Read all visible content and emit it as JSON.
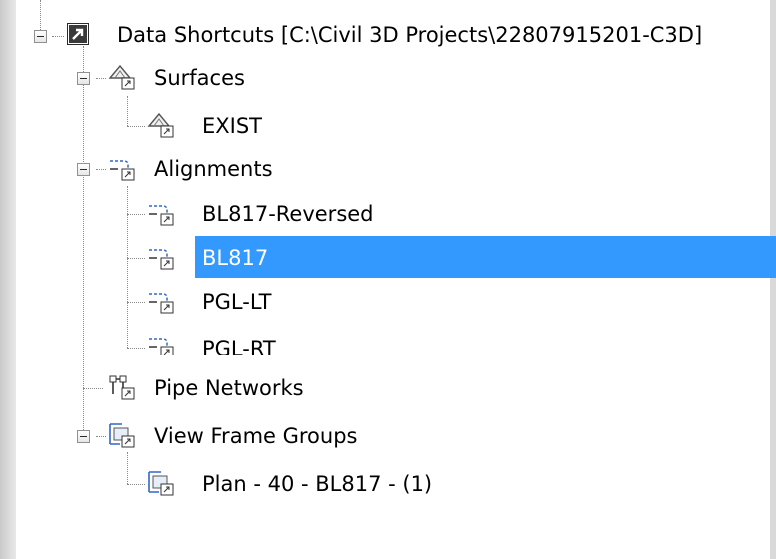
{
  "tree": {
    "root": {
      "label": "Data Shortcuts [C:\\Civil 3D Projects\\22807915201-C3D]",
      "icon": "shortcut-arrow-icon"
    },
    "surfaces": {
      "label": "Surfaces",
      "icon": "surface-icon",
      "children": [
        {
          "label": "EXIST",
          "icon": "surface-icon"
        }
      ]
    },
    "alignments": {
      "label": "Alignments",
      "icon": "alignment-icon",
      "children": [
        {
          "label": "BL817-Reversed",
          "icon": "alignment-icon"
        },
        {
          "label": "BL817",
          "icon": "alignment-icon",
          "selected": true
        },
        {
          "label": "PGL-LT",
          "icon": "alignment-icon"
        },
        {
          "label": "PGL-RT",
          "icon": "alignment-icon"
        }
      ]
    },
    "pipe_networks": {
      "label": "Pipe Networks",
      "icon": "pipe-network-icon"
    },
    "view_frame_groups": {
      "label": "View Frame Groups",
      "icon": "view-frame-icon",
      "children": [
        {
          "label": "Plan - 40 - BL817 - (1)",
          "icon": "view-frame-icon"
        }
      ]
    }
  },
  "colors": {
    "selection": "#3399ff",
    "selection_text": "#ffffff",
    "tree_lines": "#8a8a8a"
  }
}
